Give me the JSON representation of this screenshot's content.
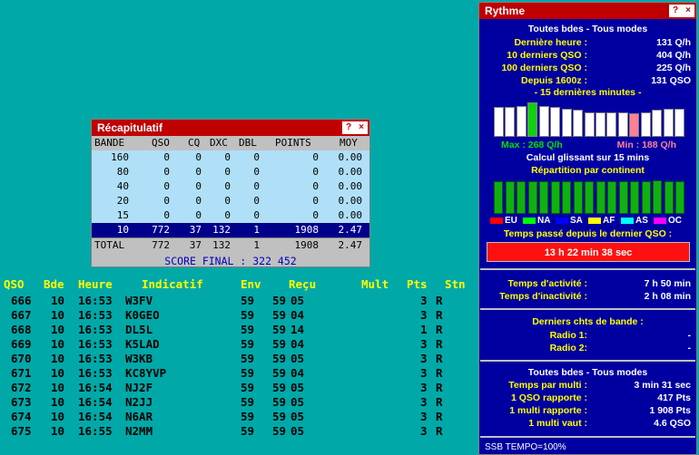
{
  "recap": {
    "title": "Récapitulatif",
    "help_label": "?",
    "close_label": "×",
    "headers": [
      "BANDE",
      "QSO",
      "CQ",
      "DXC",
      "DBL",
      "POINTS",
      "MOY"
    ],
    "rows": [
      [
        "160",
        "0",
        "0",
        "0",
        "0",
        "0",
        "0.00"
      ],
      [
        "80",
        "0",
        "0",
        "0",
        "0",
        "0",
        "0.00"
      ],
      [
        "40",
        "0",
        "0",
        "0",
        "0",
        "0",
        "0.00"
      ],
      [
        "20",
        "0",
        "0",
        "0",
        "0",
        "0",
        "0.00"
      ],
      [
        "15",
        "0",
        "0",
        "0",
        "0",
        "0",
        "0.00"
      ],
      [
        "10",
        "772",
        "37",
        "132",
        "1",
        "1908",
        "2.47"
      ]
    ],
    "total": [
      "TOTAL",
      "772",
      "37",
      "132",
      "1",
      "1908",
      "2.47"
    ],
    "score_final": "SCORE FINAL : 322 452"
  },
  "log": {
    "headers": [
      "QSO",
      "Bde",
      "Heure",
      "Indicatif",
      "Env",
      "Reçu",
      "Mult",
      "Pts",
      "Stn"
    ],
    "rows": [
      [
        "666",
        "10",
        "16:53",
        "W3FV",
        "59",
        "59",
        "05",
        "3",
        "R"
      ],
      [
        "667",
        "10",
        "16:53",
        "K0GEO",
        "59",
        "59",
        "04",
        "3",
        "R"
      ],
      [
        "668",
        "10",
        "16:53",
        "DL5L",
        "59",
        "59",
        "14",
        "1",
        "R"
      ],
      [
        "669",
        "10",
        "16:53",
        "K5LAD",
        "59",
        "59",
        "04",
        "3",
        "R"
      ],
      [
        "670",
        "10",
        "16:53",
        "W3KB",
        "59",
        "59",
        "05",
        "3",
        "R"
      ],
      [
        "671",
        "10",
        "16:53",
        "KC8YVP",
        "59",
        "59",
        "04",
        "3",
        "R"
      ],
      [
        "672",
        "10",
        "16:54",
        "NJ2F",
        "59",
        "59",
        "05",
        "3",
        "R"
      ],
      [
        "673",
        "10",
        "16:54",
        "N2JJ",
        "59",
        "59",
        "05",
        "3",
        "R"
      ],
      [
        "674",
        "10",
        "16:54",
        "N6AR",
        "59",
        "59",
        "05",
        "3",
        "R"
      ],
      [
        "675",
        "10",
        "16:55",
        "N2MM",
        "59",
        "59",
        "05",
        "3",
        "R"
      ]
    ]
  },
  "rythme": {
    "title": "Rythme",
    "help_label": "?",
    "close_label": "×",
    "section_all": "Toutes bdes - Tous modes",
    "stats": [
      {
        "label": "Dernière heure :",
        "value": "131 Q/h"
      },
      {
        "label": "10 derniers QSO :",
        "value": "404 Q/h"
      },
      {
        "label": "100 derniers QSO :",
        "value": "225 Q/h"
      },
      {
        "label": "Depuis 1600z :",
        "value": "131 QSO"
      }
    ],
    "last15": "- 15 dernières minutes -",
    "bar_levels": [
      0.82,
      0.82,
      0.86,
      0.96,
      0.86,
      0.82,
      0.78,
      0.74,
      0.68,
      0.68,
      0.68,
      0.68,
      0.64,
      0.68,
      0.74,
      0.78,
      0.78
    ],
    "bar_highlight": {
      "max_index": 3,
      "min_index": 12
    },
    "max_label": "Max : 268 Q/h",
    "min_label": "Min : 188 Q/h",
    "glissant": "Calcul glissant sur 15 mins",
    "repartition": "Répartition par continent",
    "continent_levels": [
      0.9,
      0.9,
      0.9,
      0.9,
      0.9,
      0.9,
      0.9,
      0.9,
      0.9,
      0.9,
      0.9,
      0.9,
      0.9,
      0.9,
      0.93,
      0.9,
      0.9
    ],
    "legend": [
      {
        "label": "EU",
        "color": "#ff0000"
      },
      {
        "label": "NA",
        "color": "#00ff00"
      },
      {
        "label": "SA",
        "color": "#0000ff"
      },
      {
        "label": "AF",
        "color": "#ffff00"
      },
      {
        "label": "AS",
        "color": "#00ffff"
      },
      {
        "label": "OC",
        "color": "#ff00ff"
      }
    ],
    "temps_passe_label": "Temps passé depuis le dernier QSO :",
    "temps_passe_value": "13 h 22 min 38 sec",
    "activity": [
      {
        "label": "Temps d'activité :",
        "value": "7 h 50 min"
      },
      {
        "label": "Temps d'inactivité :",
        "value": "2 h 08 min"
      }
    ],
    "derniers_chts": "Derniers chts de bande :",
    "radios": [
      {
        "label": "Radio 1:",
        "value": "-"
      },
      {
        "label": "Radio 2:",
        "value": "-"
      }
    ],
    "section_all2": "Toutes bdes - Tous modes",
    "multi": [
      {
        "label": "Temps par multi :",
        "value": "3 min 31 sec"
      },
      {
        "label": "1 QSO rapporte :",
        "value": "417 Pts"
      },
      {
        "label": "1 multi rapporte :",
        "value": "1 908 Pts"
      },
      {
        "label": "1 multi vaut :",
        "value": "4.6 QSO"
      }
    ],
    "footer": "SSB  TEMPO=100%"
  }
}
